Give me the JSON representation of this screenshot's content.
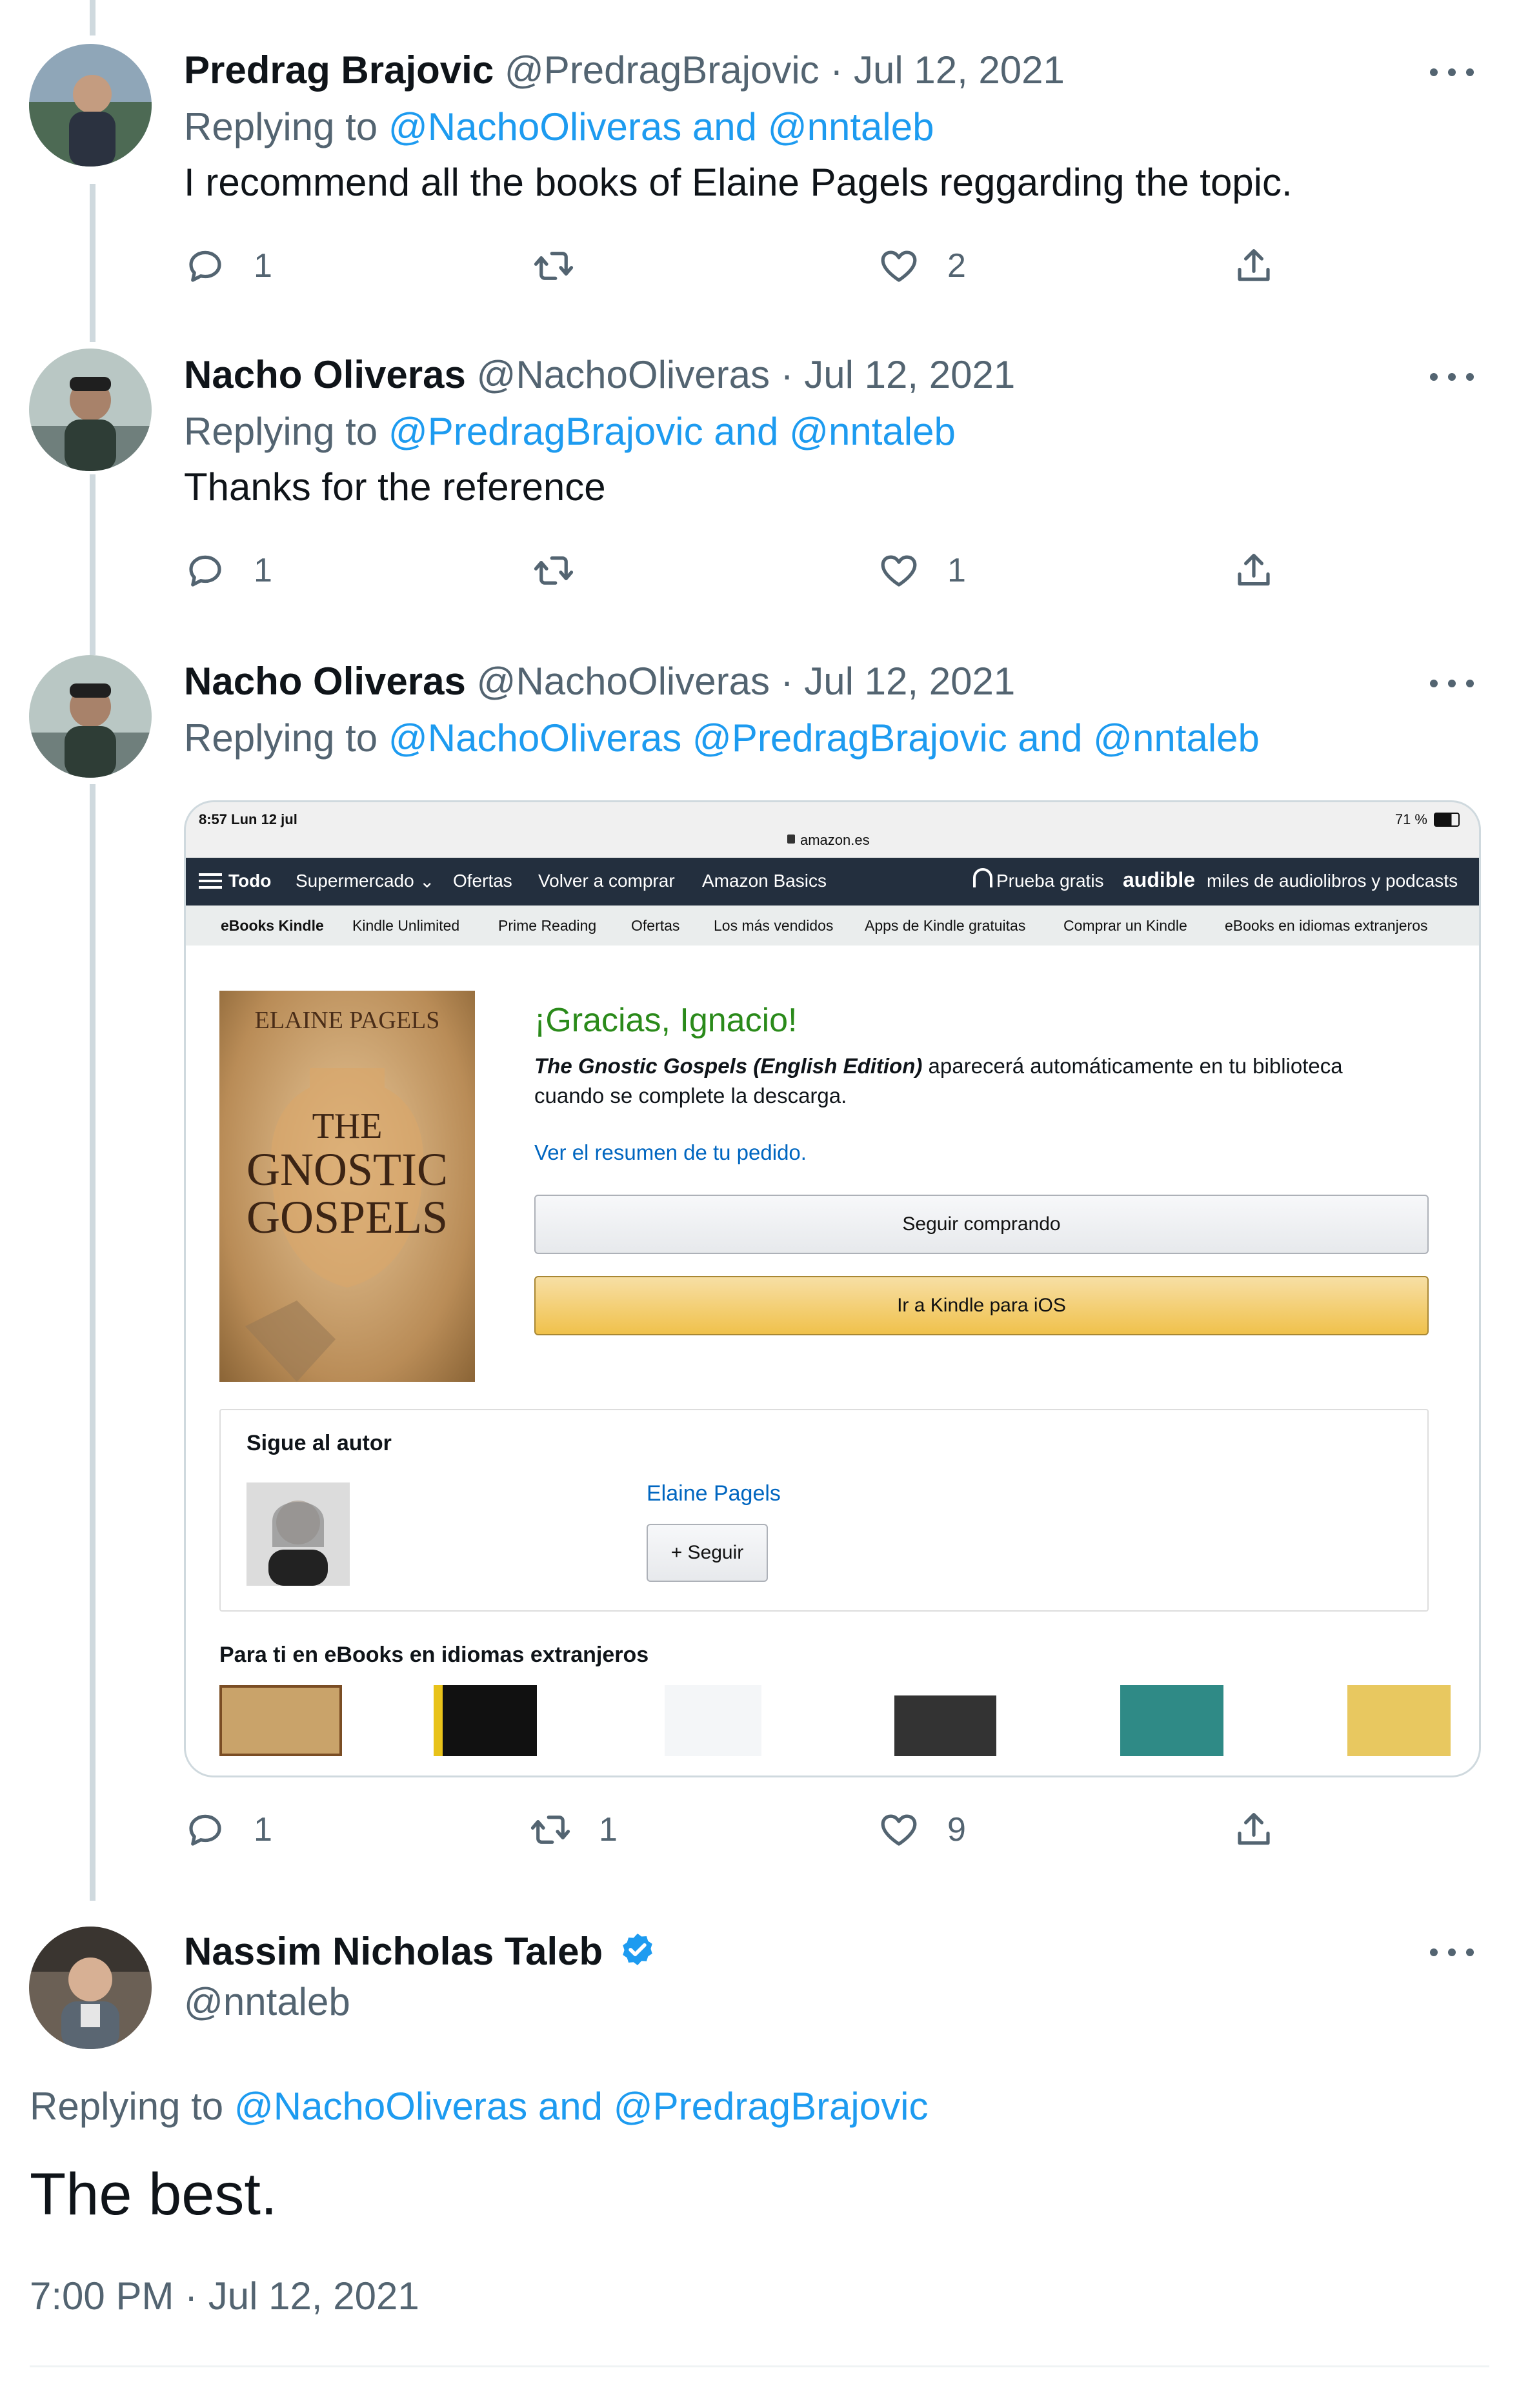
{
  "tweets": [
    {
      "name": "Predrag Brajovic",
      "handle": "@PredragBrajovic",
      "date": "· Jul 12, 2021",
      "replying_prefix": "Replying to",
      "replying_to": "@NachoOliveras and @nntaleb",
      "text": "I recommend all the books of Elaine Pagels reggarding the topic.",
      "replies": "1",
      "retweets": "",
      "likes": "2"
    },
    {
      "name": "Nacho Oliveras",
      "handle": "@NachoOliveras",
      "date": "· Jul 12, 2021",
      "replying_prefix": "Replying to",
      "replying_to": "@PredragBrajovic and @nntaleb",
      "text": "Thanks for the reference",
      "replies": "1",
      "retweets": "",
      "likes": "1"
    },
    {
      "name": "Nacho Oliveras",
      "handle": "@NachoOliveras",
      "date": "· Jul 12, 2021",
      "replying_prefix": "Replying to",
      "replying_to": "@NachoOliveras @PredragBrajovic and @nntaleb",
      "replies": "1",
      "retweets": "1",
      "likes": "9"
    }
  ],
  "embedded_screenshot": {
    "status_time": "8:57  Lun 12 jul",
    "status_battery": "71 %",
    "url": "amazon.es",
    "nav": [
      "Todo",
      "Supermercado",
      "Ofertas",
      "Volver a comprar",
      "Amazon Basics"
    ],
    "nav_promo": "Prueba gratis",
    "nav_promo_brand": "audible",
    "nav_promo_tail": "miles de audiolibros y podcasts",
    "subnav": [
      "eBooks Kindle",
      "Kindle Unlimited",
      "Prime Reading",
      "Ofertas",
      "Los más vendidos",
      "Apps de Kindle gratuitas",
      "Comprar un Kindle",
      "eBooks en idiomas extranjeros"
    ],
    "book_cover_author": "ELAINE PAGELS",
    "book_cover_title_1": "THE",
    "book_cover_title_2": "GNOSTIC",
    "book_cover_title_3": "GOSPELS",
    "thanks": "¡Gracias, Ignacio!",
    "book_title": "The Gnostic Gospels (English Edition)",
    "delivery_msg_1": " aparecerá automáticamente en tu biblioteca",
    "delivery_msg_2": "cuando se complete la descarga.",
    "order_link": "Ver el resumen de tu pedido.",
    "continue_btn": "Seguir comprando",
    "kindle_btn": "Ir a Kindle para iOS",
    "follow_heading": "Sigue al autor",
    "author_name": "Elaine Pagels",
    "follow_btn": "+ Seguir",
    "recs_heading": "Para ti en eBooks en idiomas extranjeros"
  },
  "main_tweet": {
    "name": "Nassim Nicholas Taleb",
    "handle": "@nntaleb",
    "replying_prefix": "Replying to",
    "replying_to": "@NachoOliveras and @PredragBrajovic",
    "text": "The best.",
    "timestamp": "7:00 PM · Jul 12, 2021"
  },
  "colors": {
    "link": "#1d9bf0",
    "muted": "#536471",
    "verified": "#1d9bf0",
    "thread_line": "#cfd9de"
  }
}
